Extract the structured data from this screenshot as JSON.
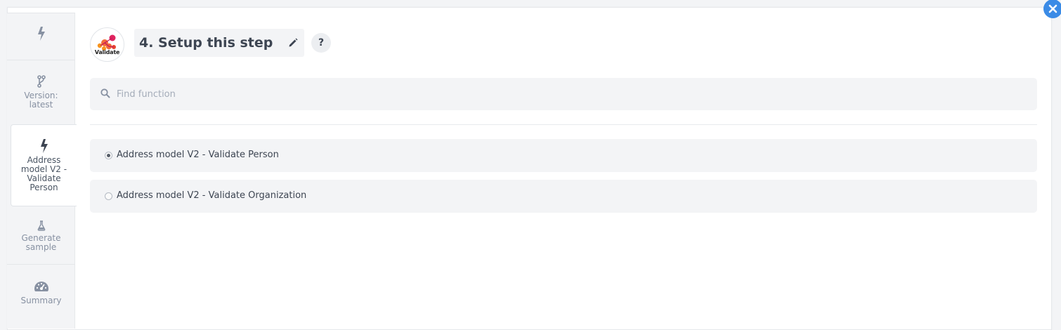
{
  "sidebar": {
    "items": [
      {
        "icon": "bolt-icon",
        "label": ""
      },
      {
        "icon": "branch-icon",
        "label": "Version: latest"
      },
      {
        "icon": "bolt-icon",
        "label": "Address model V2 - Validate Person",
        "active": true
      },
      {
        "icon": "flask-icon",
        "label": "Generate sample"
      },
      {
        "icon": "dashboard-icon",
        "label": "Summary"
      }
    ]
  },
  "header": {
    "logo_text": "Validate",
    "title": "4. Setup this step",
    "help_label": "?"
  },
  "search": {
    "placeholder": "Find function",
    "value": ""
  },
  "options": [
    {
      "label": "Address model V2 - Validate Person",
      "selected": true
    },
    {
      "label": "Address model V2 - Validate Organization",
      "selected": false
    }
  ],
  "colors": {
    "accent": "#3b8be6",
    "background": "#f3f4f6",
    "panel": "#ffffff"
  }
}
